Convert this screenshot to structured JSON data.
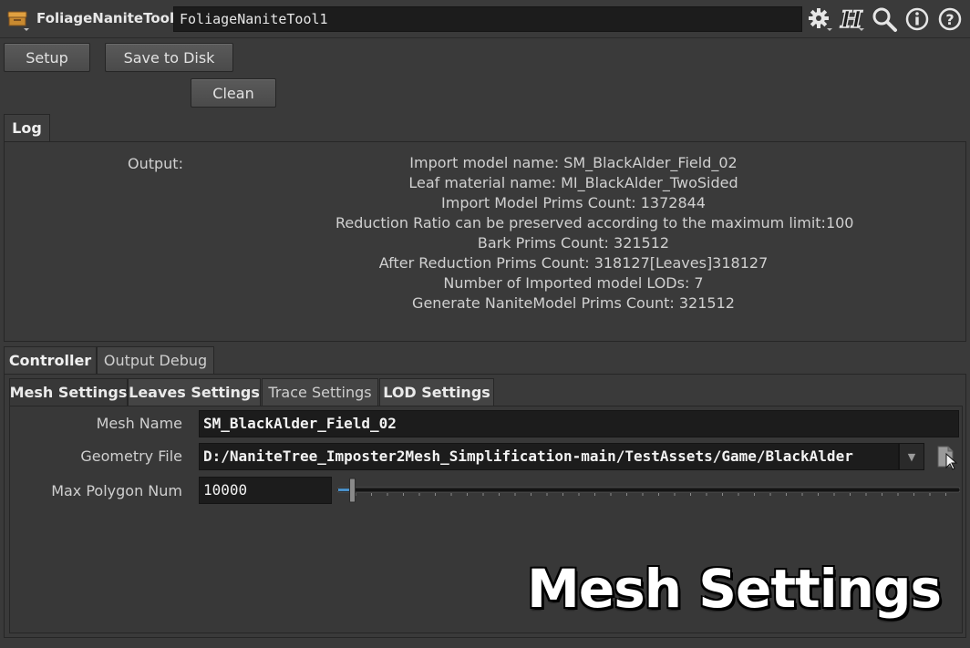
{
  "titlebar": {
    "node_type": "FoliageNaniteTool",
    "node_name": "FoliageNaniteTool1",
    "icons": [
      "node-box-icon",
      "gear-icon",
      "houdini-icon",
      "search-icon",
      "info-icon",
      "help-icon"
    ]
  },
  "buttons": {
    "setup": "Setup",
    "save_to_disk": "Save to Disk",
    "clean": "Clean"
  },
  "log": {
    "tab_label": "Log",
    "output_label": "Output:",
    "lines": [
      "Import model name: SM_BlackAlder_Field_02",
      "Leaf material name: MI_BlackAlder_TwoSided",
      "Import Model Prims Count: 1372844",
      "Reduction Ratio can be preserved according to the maximum limit:100",
      "Bark Prims Count: 321512",
      "After Reduction Prims Count: 318127[Leaves]318127",
      "Number of Imported model LODs: 7",
      "Generate NaniteModel Prims Count: 321512"
    ]
  },
  "tabs": {
    "controller": "Controller",
    "output_debug": "Output Debug"
  },
  "sub_tabs": {
    "mesh_settings": "Mesh Settings",
    "leaves_settings": "Leaves Settings",
    "trace_settings": "Trace Settings",
    "lod_settings": "LOD Settings"
  },
  "params": {
    "mesh_name_label": "Mesh Name",
    "mesh_name_value": "SM_BlackAlder_Field_02",
    "geometry_file_label": "Geometry File",
    "geometry_file_value": "D:/NaniteTree_Imposter2Mesh_Simplification-main/TestAssets/Game/BlackAlder",
    "max_polygon_label": "Max Polygon Num",
    "max_polygon_value": "10000",
    "slider_fraction": 0.02
  },
  "watermark": "Mesh Settings",
  "colors": {
    "background": "#3a3a3a",
    "field": "#1c1c1c",
    "text": "#d4d4d4",
    "slider_handle": "#4a90c8"
  }
}
